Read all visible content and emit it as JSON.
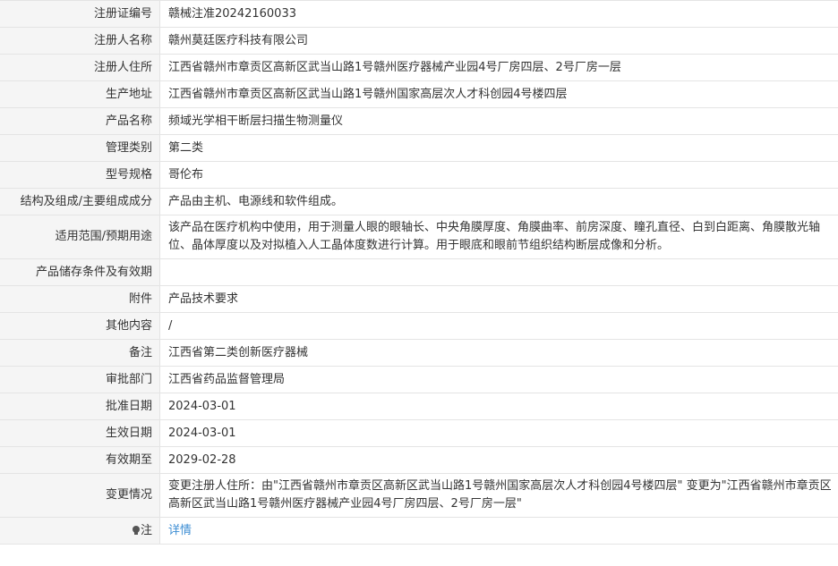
{
  "rows": [
    {
      "label": "注册证编号",
      "value": "赣械注准20242160033"
    },
    {
      "label": "注册人名称",
      "value": "赣州莫廷医疗科技有限公司"
    },
    {
      "label": "注册人住所",
      "value": "江西省赣州市章贡区高新区武当山路1号赣州医疗器械产业园4号厂房四层、2号厂房一层"
    },
    {
      "label": "生产地址",
      "value": "江西省赣州市章贡区高新区武当山路1号赣州国家高层次人才科创园4号楼四层"
    },
    {
      "label": "产品名称",
      "value": "频域光学相干断层扫描生物测量仪"
    },
    {
      "label": "管理类别",
      "value": "第二类"
    },
    {
      "label": "型号规格",
      "value": "哥伦布"
    },
    {
      "label": "结构及组成/主要组成成分",
      "value": "产品由主机、电源线和软件组成。"
    },
    {
      "label": "适用范围/预期用途",
      "value": "该产品在医疗机构中使用，用于测量人眼的眼轴长、中央角膜厚度、角膜曲率、前房深度、瞳孔直径、白到白距离、角膜散光轴位、晶体厚度以及对拟植入人工晶体度数进行计算。用于眼底和眼前节组织结构断层成像和分析。"
    },
    {
      "label": "产品储存条件及有效期",
      "value": ""
    },
    {
      "label": "附件",
      "value": "产品技术要求"
    },
    {
      "label": "其他内容",
      "value": "/"
    },
    {
      "label": "备注",
      "value": "江西省第二类创新医疗器械"
    },
    {
      "label": "审批部门",
      "value": "江西省药品监督管理局"
    },
    {
      "label": "批准日期",
      "value": "2024-03-01"
    },
    {
      "label": "生效日期",
      "value": "2024-03-01"
    },
    {
      "label": "有效期至",
      "value": "2029-02-28"
    },
    {
      "label": "变更情况",
      "value": "变更注册人住所：由\"江西省赣州市章贡区高新区武当山路1号赣州国家高层次人才科创园4号楼四层\" 变更为\"江西省赣州市章贡区高新区武当山路1号赣州医疗器械产业园4号厂房四层、2号厂房一层\""
    }
  ],
  "note": {
    "icon": "lightbulb-icon",
    "label": "注",
    "link_text": "详情",
    "link_color": "#3c8dd3"
  }
}
